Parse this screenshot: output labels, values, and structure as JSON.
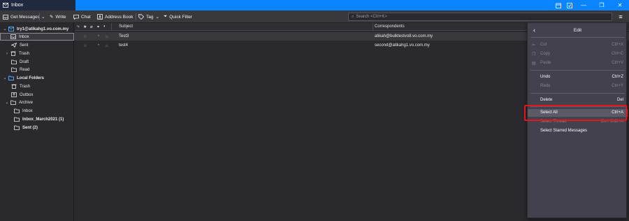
{
  "window": {
    "tab_title": "Inbox"
  },
  "toolbar": {
    "get_messages": "Get Messages",
    "write": "Write",
    "chat": "Chat",
    "address_book": "Address Book",
    "tag": "Tag",
    "quick_filter": "Quick Filter",
    "search_placeholder": "Search <Ctrl+K>"
  },
  "folders": {
    "account": "try1@atikahg1.vo.com.my",
    "inbox": "Inbox",
    "sent": "Sent",
    "trash": "Trash",
    "draft": "Draft",
    "read": "Read",
    "local": "Local Folders",
    "local_trash": "Trash",
    "outbox": "Outbox",
    "archive": "Archive",
    "archive_inbox": "Inbox",
    "inbox_march": "Inbox_March2021 (1)",
    "archive_sent": "Sent (2)"
  },
  "columns": {
    "subject": "Subject",
    "correspondents": "Correspondents"
  },
  "messages": [
    {
      "subject": "Test3",
      "correspondent": "atikah@bulktestvo8.vo.com.my"
    },
    {
      "subject": "test4",
      "correspondent": "second@atikahg1.vo.com.my"
    }
  ],
  "menu": {
    "title": "Edit",
    "cut": "Cut",
    "cut_key": "Ctrl+X",
    "copy": "Copy",
    "copy_key": "Ctrl+C",
    "paste": "Paste",
    "paste_key": "Ctrl+V",
    "undo": "Undo",
    "undo_key": "Ctrl+Z",
    "redo": "Redo",
    "redo_key": "Ctrl+Y",
    "delete": "Delete",
    "delete_key": "Del",
    "select_all": "Select All",
    "select_all_key": "Ctrl+A",
    "select_thread": "Select Thread",
    "select_thread_key": "Ctrl+Shift+A",
    "select_starred": "Select Starred Messages"
  },
  "colors": {
    "accent": "#0a84ff",
    "highlight": "#e8141c"
  }
}
